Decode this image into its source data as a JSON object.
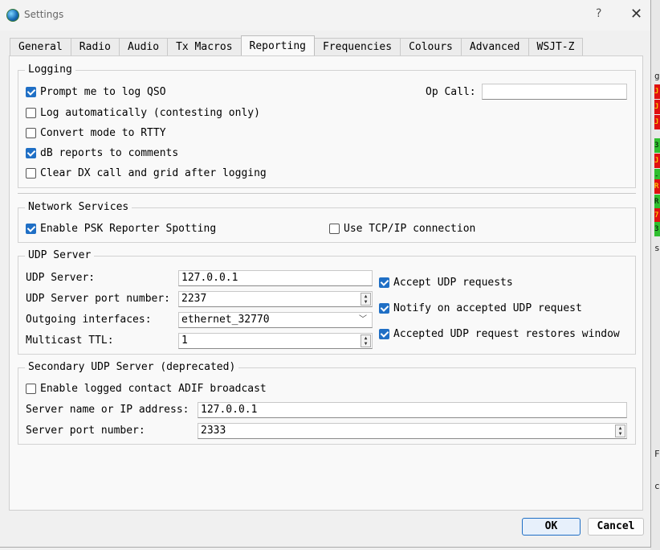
{
  "window": {
    "title": "Settings",
    "help_glyph": "?",
    "close_glyph": "✕"
  },
  "tabs": [
    {
      "label": "General"
    },
    {
      "label": "Radio"
    },
    {
      "label": "Audio"
    },
    {
      "label": "Tx Macros"
    },
    {
      "label": "Reporting"
    },
    {
      "label": "Frequencies"
    },
    {
      "label": "Colours"
    },
    {
      "label": "Advanced"
    },
    {
      "label": "WSJT-Z"
    }
  ],
  "active_tab": "Reporting",
  "logging": {
    "title": "Logging",
    "prompt_log_qso": {
      "label": "Prompt me to log QSO",
      "checked": true
    },
    "log_automatically": {
      "label": "Log automatically (contesting only)",
      "checked": false
    },
    "convert_rtty": {
      "label": "Convert mode to RTTY",
      "checked": false
    },
    "db_reports": {
      "label": "dB reports to comments",
      "checked": true
    },
    "clear_dx": {
      "label": "Clear DX call and grid after logging",
      "checked": false
    },
    "op_call_label": "Op Call:",
    "op_call_value": ""
  },
  "network": {
    "title": "Network Services",
    "psk_reporter": {
      "label": "Enable PSK Reporter Spotting",
      "checked": true
    },
    "tcp_ip": {
      "label": "Use TCP/IP connection",
      "checked": false
    }
  },
  "udp": {
    "title": "UDP Server",
    "server_label": "UDP Server:",
    "server_value": "127.0.0.1",
    "port_label": "UDP Server port number:",
    "port_value": "2237",
    "interfaces_label": "Outgoing interfaces:",
    "interfaces_value": "ethernet_32770",
    "ttl_label": "Multicast TTL:",
    "ttl_value": "1",
    "accept_requests": {
      "label": "Accept UDP requests",
      "checked": true
    },
    "notify_accepted": {
      "label": "Notify on accepted UDP request",
      "checked": true
    },
    "restores_window": {
      "label": "Accepted UDP request restores window",
      "checked": true
    }
  },
  "secondary": {
    "title": "Secondary UDP Server (deprecated)",
    "adif_broadcast": {
      "label": "Enable logged contact ADIF broadcast",
      "checked": false
    },
    "server_label": "Server name or IP address:",
    "server_value": "127.0.0.1",
    "port_label": "Server port number:",
    "port_value": "2333"
  },
  "buttons": {
    "ok": "OK",
    "cancel": "Cancel"
  },
  "background_strip": {
    "cells": [
      "J",
      "J",
      "J",
      "3",
      "J",
      "-",
      "R",
      "R",
      "7",
      "3"
    ],
    "marks": [
      "g",
      "s",
      "F",
      "c"
    ]
  },
  "colors": {
    "accent": "#1f6fc5",
    "strip_red": "#e01010",
    "strip_green": "#2fbf2f"
  }
}
